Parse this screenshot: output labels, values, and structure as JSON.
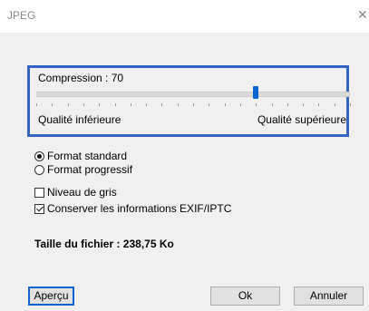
{
  "window": {
    "title": "JPEG",
    "close_glyph": "✕"
  },
  "compression": {
    "label": "Compression : 70",
    "value": 70,
    "low_label": "Qualité inférieure",
    "high_label": "Qualité supérieure"
  },
  "format": {
    "options": [
      {
        "label": "Format standard",
        "selected": true
      },
      {
        "label": "Format progressif",
        "selected": false
      }
    ]
  },
  "options": {
    "grayscale": {
      "label": "Niveau de gris",
      "checked": false
    },
    "exif": {
      "label": "Conserver les informations EXIF/IPTC",
      "checked": true
    }
  },
  "file_size": "Taille du fichier : 238,75 Ko",
  "buttons": {
    "preview": "Aperçu",
    "ok": "Ok",
    "cancel": "Annuler"
  },
  "colors": {
    "accent": "#0a64d4",
    "highlight_border": "#3366c4",
    "background": "#f0f0f0"
  }
}
